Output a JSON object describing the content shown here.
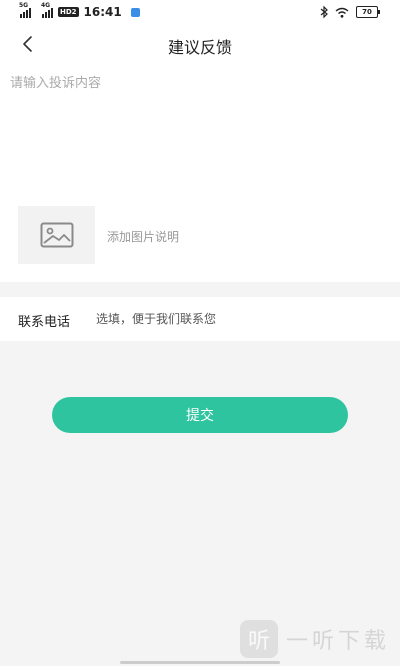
{
  "status_bar": {
    "signal_1_tag": "5G",
    "signal_2_tag": "4G",
    "hd_badge": "HD2",
    "time": "16:41",
    "battery": "70",
    "icons": [
      "signal-icon",
      "signal-icon",
      "hd-icon",
      "app-notification-icon",
      "bluetooth-icon",
      "wifi-icon",
      "battery-icon"
    ]
  },
  "nav": {
    "back_icon": "chevron-left-icon",
    "title": "建议反馈"
  },
  "feedback": {
    "content_placeholder": "请输入投诉内容",
    "image_icon": "image-icon",
    "image_hint": "添加图片说明"
  },
  "contact": {
    "label": "联系电话",
    "placeholder": "选填，便于我们联系您"
  },
  "submit": {
    "label": "提交",
    "color": "#2ec4a0"
  },
  "watermark": {
    "logo_char": "听",
    "text": "一听下载"
  }
}
